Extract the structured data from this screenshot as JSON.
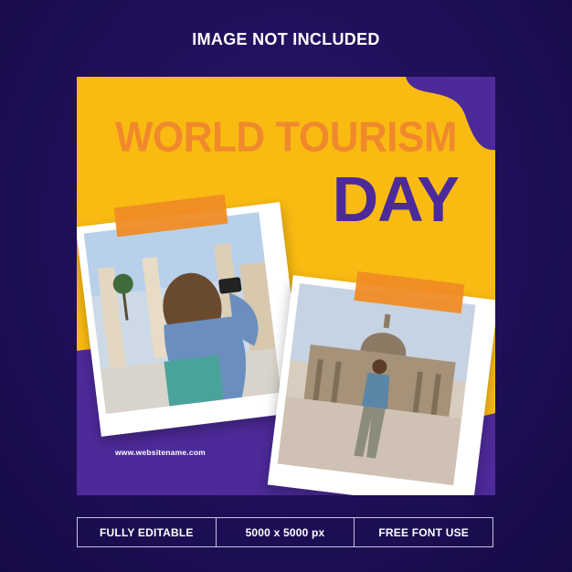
{
  "header": {
    "notice": "IMAGE NOT INCLUDED"
  },
  "poster": {
    "title_line1": "WORLD TOURISM",
    "title_line2": "DAY",
    "website": "www.websitename.com",
    "photos": [
      {
        "alt": "Woman with backpack photographing ancient columns"
      },
      {
        "alt": "Woman standing in front of St. Peter's Basilica"
      }
    ]
  },
  "features": [
    "FULLY EDITABLE",
    "5000 x 5000 px",
    "FREE FONT USE"
  ],
  "colors": {
    "background": "#1e0f57",
    "poster_yellow": "#f9bb12",
    "accent_orange": "#f0892c",
    "accent_purple": "#4d2a99"
  }
}
